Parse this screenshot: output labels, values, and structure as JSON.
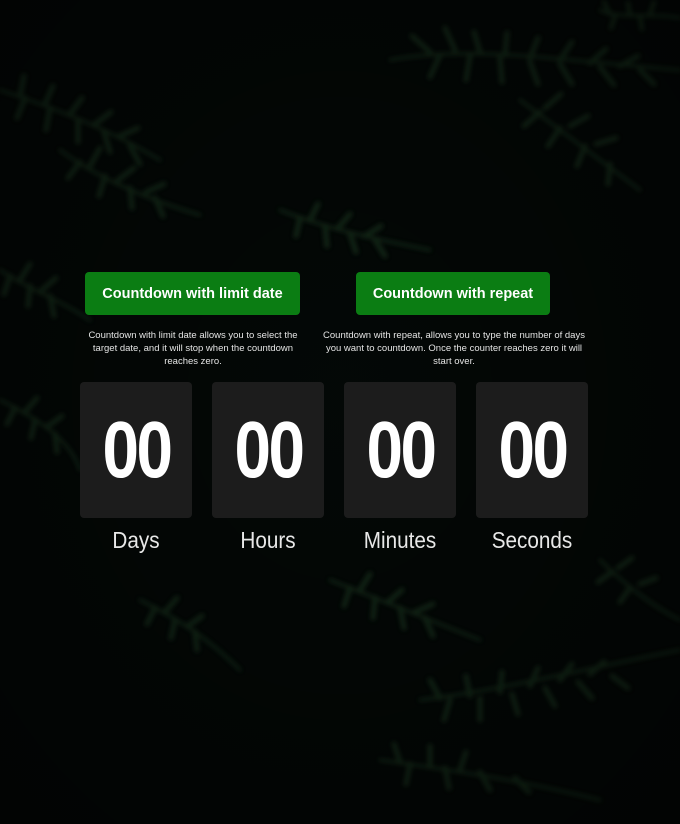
{
  "actions": {
    "limit": {
      "label": "Countdown with limit date",
      "description": "Countdown with limit date allows you to select the target date, and it will stop when the countdown reaches zero."
    },
    "repeat": {
      "label": "Countdown with repeat",
      "description": "Countdown with repeat, allows you to type the number of days you want to countdown. Once the counter reaches zero it will start over."
    }
  },
  "timer": {
    "days": {
      "value": "00",
      "label": "Days"
    },
    "hours": {
      "value": "00",
      "label": "Hours"
    },
    "minutes": {
      "value": "00",
      "label": "Minutes"
    },
    "seconds": {
      "value": "00",
      "label": "Seconds"
    }
  },
  "colors": {
    "button": "#0b7d13",
    "card": "#1c1c1c",
    "background": "#030705",
    "foliage": "#142b17"
  }
}
